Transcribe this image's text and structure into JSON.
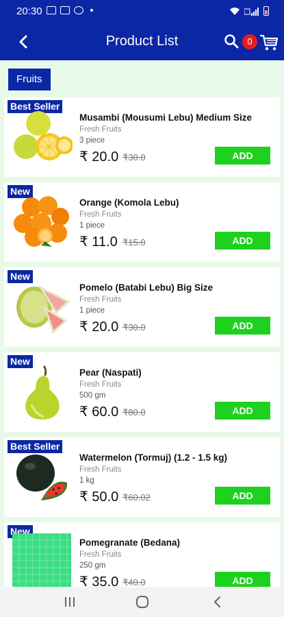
{
  "status": {
    "time": "20:30"
  },
  "appbar": {
    "title": "Product List",
    "cart_count": "0"
  },
  "category": {
    "label": "Fruits"
  },
  "products": [
    {
      "tag": "Best Seller",
      "name": "Musambi (Mousumi Lebu) Medium Size",
      "category": "Fresh Fruits",
      "qty": "3 piece",
      "price": "₹ 20.0",
      "mrp": "₹30.0",
      "add": "ADD"
    },
    {
      "tag": "New",
      "name": "Orange (Komola Lebu)",
      "category": "Fresh Fruits",
      "qty": "1 piece",
      "price": "₹ 11.0",
      "mrp": "₹15.0",
      "add": "ADD"
    },
    {
      "tag": "New",
      "name": "Pomelo (Batabi Lebu) Big Size",
      "category": "Fresh Fruits",
      "qty": "1 piece",
      "price": "₹ 20.0",
      "mrp": "₹30.0",
      "add": "ADD"
    },
    {
      "tag": "New",
      "name": "Pear (Naspati)",
      "category": "Fresh Fruits",
      "qty": "500 gm",
      "price": "₹ 60.0",
      "mrp": "₹80.0",
      "add": "ADD"
    },
    {
      "tag": "Best Seller",
      "name": "Watermelon (Tormuj) (1.2 - 1.5 kg)",
      "category": "Fresh Fruits",
      "qty": "1 kg",
      "price": "₹ 50.0",
      "mrp": "₹60.02",
      "add": "ADD"
    },
    {
      "tag": "New",
      "name": "Pomegranate (Bedana)",
      "category": "Fresh Fruits",
      "qty": "250 gm",
      "price": "₹ 35.0",
      "mrp": "₹40.0",
      "add": "ADD"
    }
  ],
  "colors": {
    "primary": "#0b27a5",
    "add_button": "#1ed11e",
    "list_bg": "#e9f9e9",
    "badge": "#ea1b1b"
  }
}
